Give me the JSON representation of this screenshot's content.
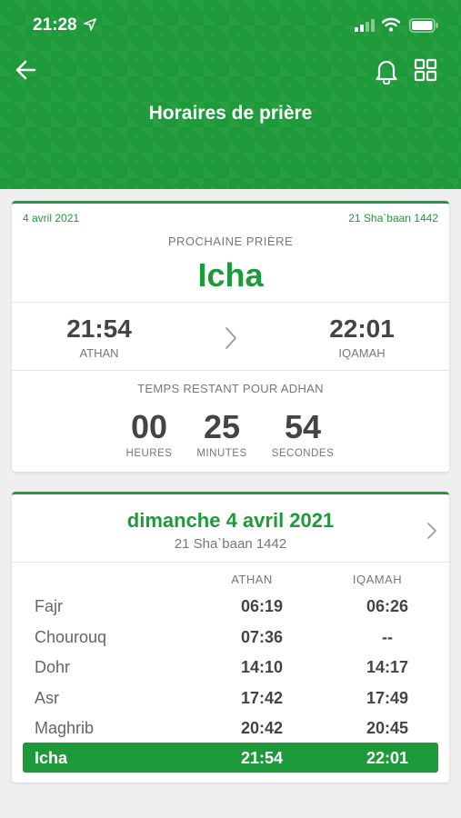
{
  "status_bar": {
    "time": "21:28"
  },
  "header": {
    "title": "Horaires de prière"
  },
  "next_prayer": {
    "gregorian_date": "4 avril 2021",
    "hijri_date": "21 Sha`baan 1442",
    "label": "PROCHAINE PRIÈRE",
    "name": "Icha",
    "athan_time": "21:54",
    "athan_label": "ATHAN",
    "iqamah_time": "22:01",
    "iqamah_label": "IQAMAH",
    "remaining_label": "TEMPS RESTANT POUR ADHAN",
    "countdown": [
      {
        "value": "00",
        "unit": "HEURES"
      },
      {
        "value": "25",
        "unit": "MINUTES"
      },
      {
        "value": "54",
        "unit": "SECONDES"
      }
    ]
  },
  "schedule": {
    "day_title": "dimanche 4 avril 2021",
    "hijri": "21 Sha`baan 1442",
    "col_athan": "ATHAN",
    "col_iqamah": "IQAMAH",
    "rows": [
      {
        "name": "Fajr",
        "athan": "06:19",
        "iqamah": "06:26"
      },
      {
        "name": "Chourouq",
        "athan": "07:36",
        "iqamah": "--"
      },
      {
        "name": "Dohr",
        "athan": "14:10",
        "iqamah": "14:17"
      },
      {
        "name": "Asr",
        "athan": "17:42",
        "iqamah": "17:49"
      },
      {
        "name": "Maghrib",
        "athan": "20:42",
        "iqamah": "20:45"
      },
      {
        "name": "Icha",
        "athan": "21:54",
        "iqamah": "22:01"
      }
    ]
  },
  "colors": {
    "primary": "#1f9a3a",
    "background": "#efefef"
  }
}
